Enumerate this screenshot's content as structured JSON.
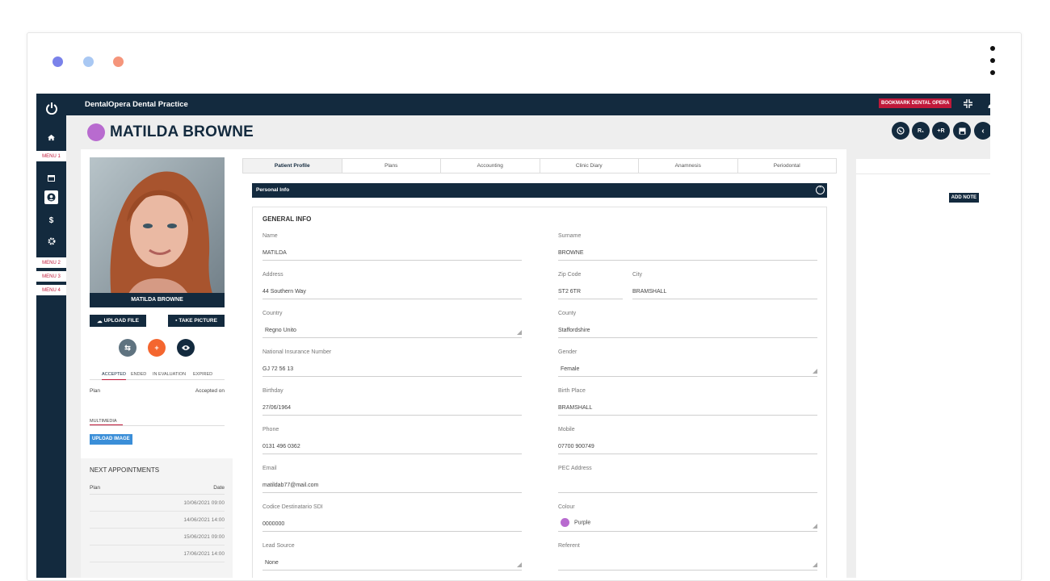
{
  "window": {
    "traffic_lights": [
      "#7a82ea",
      "#a9c8f3",
      "#f5957b"
    ]
  },
  "topbar": {
    "title": "DentalOpera Dental Practice",
    "bookmark": "BOOKMARK DENTAL OPERA"
  },
  "sidebar": {
    "menu1": "MENU 1",
    "menu2": "MENU 2",
    "menu3": "MENU 3",
    "menu4": "MENU 4"
  },
  "header": {
    "patient_name": "MATILDA BROWNE",
    "patient_color": "#b86bcf",
    "actions": [
      "R₁",
      "+R"
    ]
  },
  "left": {
    "photo_caption": "MATILDA BROWNE",
    "upload_file": "UPLOAD FILE",
    "take_picture": "TAKE PICTURE",
    "plan_tabs": [
      "ACCEPTED",
      "ENDED",
      "IN EVALUATION",
      "EXPIRED"
    ],
    "plan_col": "Plan",
    "accepted_on_col": "Accepted on",
    "multimedia": "MULTIMEDIA",
    "upload_image": "UPLOAD IMAGE",
    "next_appointments": "NEXT APPOINTMENTS",
    "appt_plan_col": "Plan",
    "appt_date_col": "Date",
    "appointments": [
      "10/06/2021 09:00",
      "14/06/2021 14:00",
      "15/06/2021 09:00",
      "17/06/2021 14:00"
    ]
  },
  "tabs": [
    "Patient Profile",
    "Plans",
    "Accounting",
    "Clinic Diary",
    "Anamnesis",
    "Periodontal"
  ],
  "section": {
    "title": "Personal Info",
    "group": "GENERAL INFO"
  },
  "fields": {
    "name_label": "Name",
    "name": "MATILDA",
    "surname_label": "Surname",
    "surname": "BROWNE",
    "address_label": "Address",
    "address": "44 Southern Way",
    "zip_label": "Zip Code",
    "zip": "ST2 6TR",
    "city_label": "City",
    "city": "BRAMSHALL",
    "country_label": "Country",
    "country": "Regno Unito",
    "county_label": "County",
    "county": "Staffordshire",
    "nin_label": "National Insurance Number",
    "nin": "GJ 72 56 13",
    "gender_label": "Gender",
    "gender": "Female",
    "birthday_label": "Birthday",
    "birthday": "27/06/1964",
    "birthplace_label": "Birth Place",
    "birthplace": "BRAMSHALL",
    "phone_label": "Phone",
    "phone": "0131 496 0362",
    "mobile_label": "Mobile",
    "mobile": "07700 900749",
    "email_label": "Email",
    "email": "matildab77@mail.com",
    "pec_label": "PEC Address",
    "pec": "",
    "sdi_label": "Codice Destinatario SDI",
    "sdi": "0000000",
    "colour_label": "Colour",
    "colour": "Purple",
    "lead_label": "Lead Source",
    "lead": "None",
    "referent_label": "Referent",
    "referent": ""
  },
  "notes": {
    "add_note": "ADD NOTE"
  }
}
